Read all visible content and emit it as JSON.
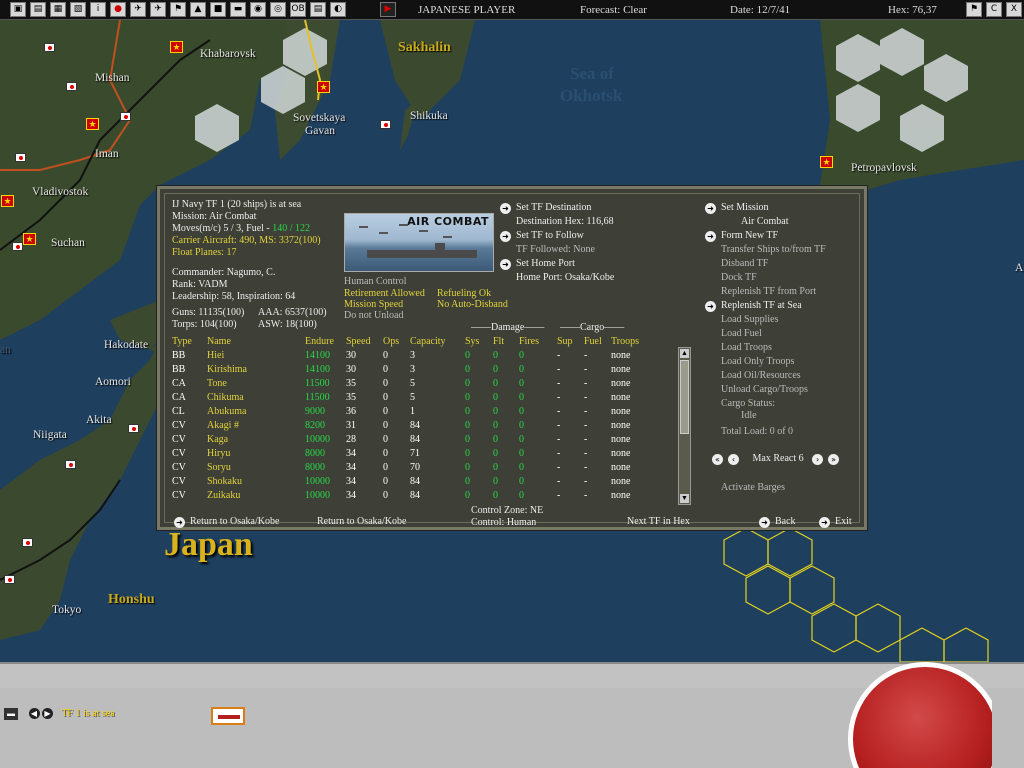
{
  "topbar": {
    "buttons": [
      "▣",
      "▤",
      "▦",
      "▧",
      "i",
      "●",
      "✈",
      "✈",
      "⚑",
      "▲",
      "■",
      "▬",
      "◉",
      "◎",
      "OB",
      "▤",
      "◐",
      "▶"
    ],
    "player": "JAPANESE PLAYER",
    "forecast": "Forecast: Clear",
    "date": "Date: 12/7/41",
    "hex": "Hex: 76,37",
    "right_buttons": [
      "⚑",
      "C",
      "X"
    ]
  },
  "map": {
    "places": [
      "Khabarovsk",
      "Sakhalin",
      "Mishan",
      "Sea of",
      "Okhotsk",
      "Sovetskaya",
      "Gavan",
      "Shikuka",
      "Iman",
      "Vladivostok",
      "Petropavlovsk",
      "Suchan",
      "Hakodate",
      "Aomori",
      "Akita",
      "Niigata",
      "Japan",
      "Honshu",
      "Tokyo",
      "an",
      "A"
    ]
  },
  "dialog": {
    "header": [
      {
        "text": "IJ Navy TF 1 (20 ships) is at sea",
        "cls": "wht"
      },
      {
        "text": "Mission:  Air Combat",
        "cls": "wht"
      },
      {
        "text": "Moves(m/c)  5 / 3, Fuel - ",
        "cls": "wht",
        "extra": "140 / 122"
      },
      {
        "text": "Carrier Aircraft: 490,  MS: 3372(100)",
        "cls": "yel"
      },
      {
        "text": "Float Planes: 17",
        "cls": "yel"
      }
    ],
    "commander": [
      "Commander: Nagumo, C.",
      "Rank: VADM",
      "Leadership: 58, Inspiration: 64"
    ],
    "weapons": [
      [
        "Guns: 11135(100)",
        "AAA: 6537(100)"
      ],
      [
        "Torps: 104(100)",
        "ASW: 18(100)"
      ]
    ],
    "picture_title": "AIR COMBAT",
    "control": {
      "human": "Human Control",
      "retirement": "Retirement Allowed",
      "refueling": "Refueling Ok",
      "mission_speed": "Mission Speed",
      "no_auto_disband": "No Auto-Disband",
      "do_not_unload": "Do not Unload"
    },
    "middle_cmds": {
      "set_dest": "Set TF Destination",
      "dest_hex": "Destination Hex: 116,68",
      "set_follow": "Set TF to Follow",
      "followed": "TF Followed: None",
      "set_home": "Set Home Port",
      "home_port": "Home Port: Osaka/Kobe"
    },
    "right_cmds": {
      "set_mission": "Set Mission",
      "mission_value": "Air Combat",
      "form_new": "Form New TF",
      "transfer": "Transfer Ships to/from TF",
      "disband": "Disband TF",
      "dock": "Dock TF",
      "replenish_port": "Replenish TF from Port",
      "replenish_sea": "Replenish TF at Sea",
      "load_supplies": "Load Supplies",
      "load_fuel": "Load Fuel",
      "load_troops": "Load Troops",
      "load_only_troops": "Load Only Troops",
      "load_oil": "Load Oil/Resources",
      "unload": "Unload Cargo/Troops",
      "cargo_status": "Cargo Status:",
      "idle": "Idle",
      "total_load": "Total Load: 0 of 0",
      "max_react": "Max React  6",
      "activate_barges": "Activate Barges"
    },
    "group_headers": {
      "damage": "——Damage——",
      "cargo": "——Cargo——"
    },
    "columns": [
      "Type",
      "Name",
      "Endure",
      "Speed",
      "Ops",
      "Capacity",
      "Sys",
      "Flt",
      "Fires",
      "Sup",
      "Fuel",
      "Troops"
    ],
    "ships": [
      [
        "BB",
        "Hiei",
        "14100",
        "30",
        "0",
        "3",
        "0",
        "0",
        "0",
        "-",
        "-",
        "none"
      ],
      [
        "BB",
        "Kirishima",
        "14100",
        "30",
        "0",
        "3",
        "0",
        "0",
        "0",
        "-",
        "-",
        "none"
      ],
      [
        "CA",
        "Tone",
        "11500",
        "35",
        "0",
        "5",
        "0",
        "0",
        "0",
        "-",
        "-",
        "none"
      ],
      [
        "CA",
        "Chikuma",
        "11500",
        "35",
        "0",
        "5",
        "0",
        "0",
        "0",
        "-",
        "-",
        "none"
      ],
      [
        "CL",
        "Abukuma",
        "9000",
        "36",
        "0",
        "1",
        "0",
        "0",
        "0",
        "-",
        "-",
        "none"
      ],
      [
        "CV",
        "Akagi #",
        "8200",
        "31",
        "0",
        "84",
        "0",
        "0",
        "0",
        "-",
        "-",
        "none"
      ],
      [
        "CV",
        "Kaga",
        "10000",
        "28",
        "0",
        "84",
        "0",
        "0",
        "0",
        "-",
        "-",
        "none"
      ],
      [
        "CV",
        "Hiryu",
        "8000",
        "34",
        "0",
        "71",
        "0",
        "0",
        "0",
        "-",
        "-",
        "none"
      ],
      [
        "CV",
        "Soryu",
        "8000",
        "34",
        "0",
        "70",
        "0",
        "0",
        "0",
        "-",
        "-",
        "none"
      ],
      [
        "CV",
        "Shokaku",
        "10000",
        "34",
        "0",
        "84",
        "0",
        "0",
        "0",
        "-",
        "-",
        "none"
      ],
      [
        "CV",
        "Zuikaku",
        "10000",
        "34",
        "0",
        "84",
        "0",
        "0",
        "0",
        "-",
        "-",
        "none"
      ]
    ],
    "footer": {
      "return_btn": "Return to Osaka/Kobe",
      "return_text": "Return to Osaka/Kobe",
      "control_zone": "Control Zone: NE",
      "control": "Control:    Human",
      "next_tf": "Next TF in Hex",
      "back": "Back",
      "exit": "Exit"
    }
  },
  "bottom": {
    "status": "TF 1 is at sea"
  }
}
